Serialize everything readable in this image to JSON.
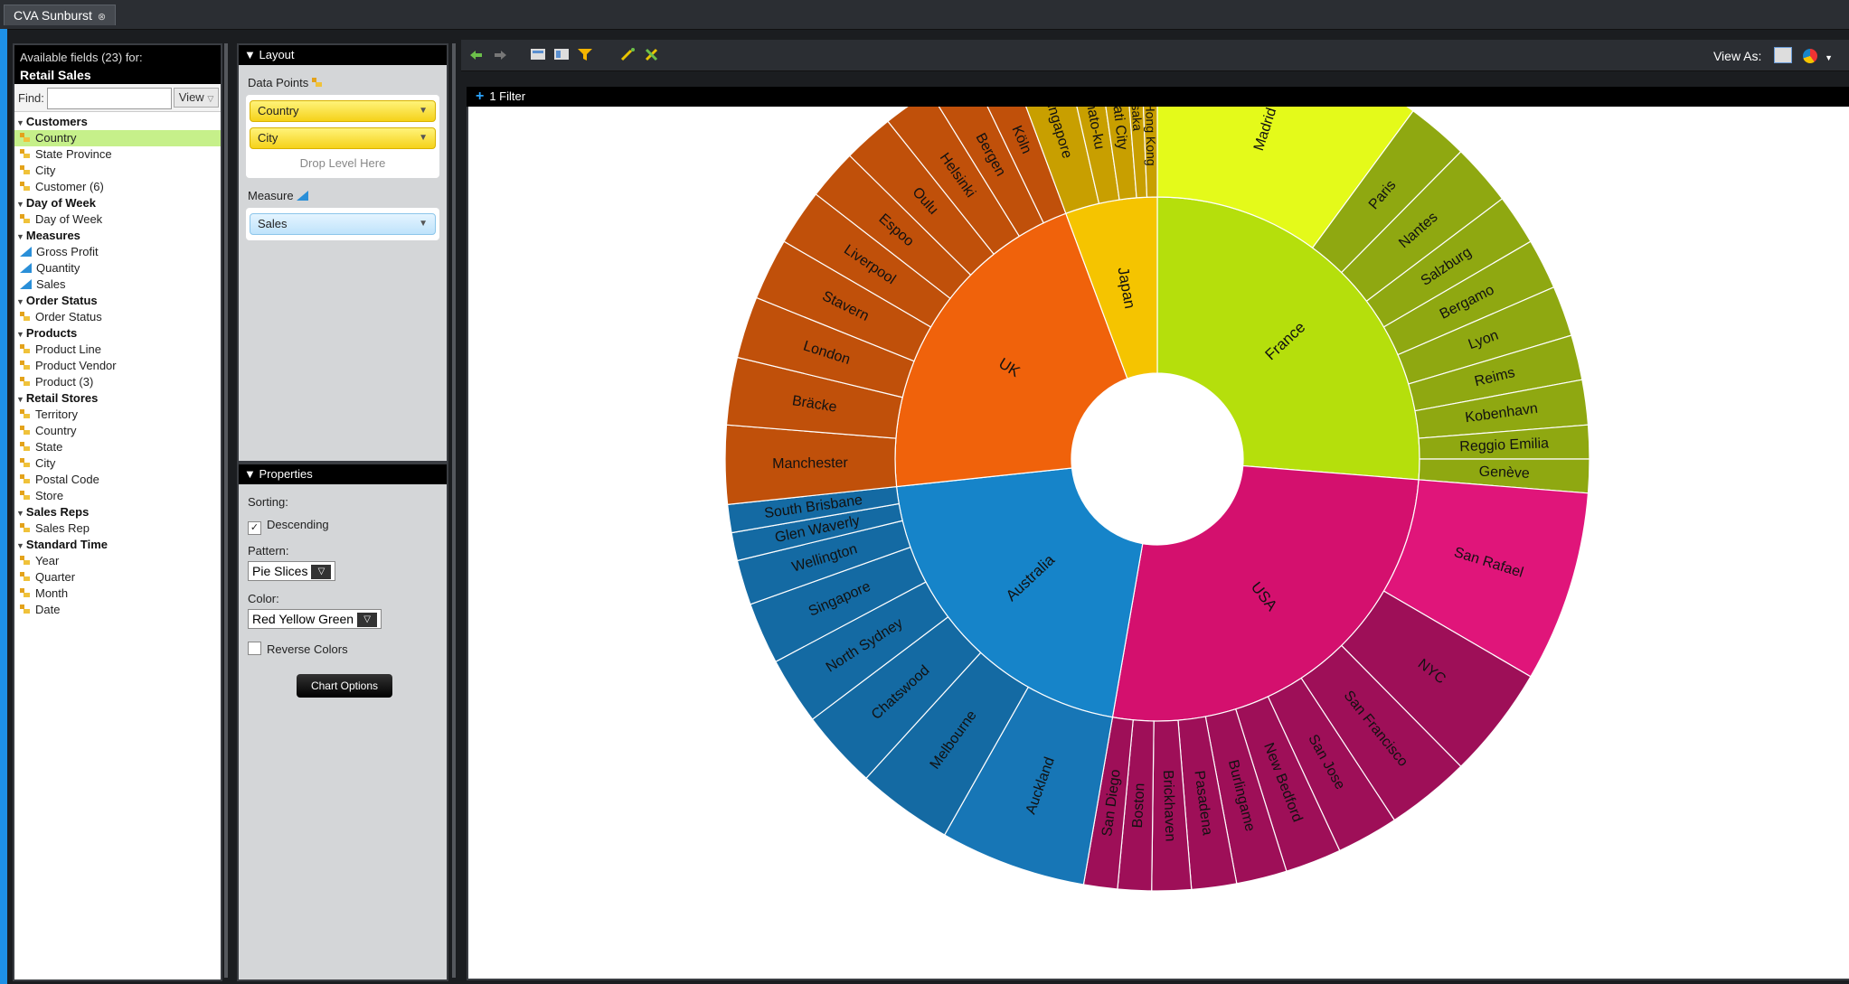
{
  "tab": {
    "title": "CVA Sunburst"
  },
  "fields": {
    "header": "Available fields (23) for:",
    "source": "Retail Sales",
    "find_label": "Find:",
    "find_value": "",
    "view_label": "View",
    "tree": [
      {
        "type": "cat",
        "label": "Customers"
      },
      {
        "type": "dim",
        "label": "Country",
        "selected": true
      },
      {
        "type": "dim",
        "label": "State Province"
      },
      {
        "type": "dim",
        "label": "City"
      },
      {
        "type": "dim",
        "label": "Customer (6)"
      },
      {
        "type": "cat",
        "label": "Day of Week"
      },
      {
        "type": "dim",
        "label": "Day of Week"
      },
      {
        "type": "cat",
        "label": "Measures"
      },
      {
        "type": "meas",
        "label": "Gross Profit"
      },
      {
        "type": "meas",
        "label": "Quantity"
      },
      {
        "type": "meas",
        "label": "Sales"
      },
      {
        "type": "cat",
        "label": "Order Status"
      },
      {
        "type": "dim",
        "label": "Order Status"
      },
      {
        "type": "cat",
        "label": "Products"
      },
      {
        "type": "dim",
        "label": "Product Line"
      },
      {
        "type": "dim",
        "label": "Product Vendor"
      },
      {
        "type": "dim",
        "label": "Product (3)"
      },
      {
        "type": "cat",
        "label": "Retail Stores"
      },
      {
        "type": "dim",
        "label": "Territory"
      },
      {
        "type": "dim",
        "label": "Country"
      },
      {
        "type": "dim",
        "label": "State"
      },
      {
        "type": "dim",
        "label": "City"
      },
      {
        "type": "dim",
        "label": "Postal Code"
      },
      {
        "type": "dim",
        "label": "Store"
      },
      {
        "type": "cat",
        "label": "Sales Reps"
      },
      {
        "type": "dim",
        "label": "Sales Rep"
      },
      {
        "type": "cat",
        "label": "Standard Time"
      },
      {
        "type": "dim",
        "label": "Year"
      },
      {
        "type": "dim",
        "label": "Quarter"
      },
      {
        "type": "dim",
        "label": "Month"
      },
      {
        "type": "dim",
        "label": "Date"
      }
    ]
  },
  "layout": {
    "title": "▼ Layout",
    "data_points_label": "Data Points",
    "data_points": [
      "Country",
      "City"
    ],
    "drop_level": "Drop Level Here",
    "measure_label": "Measure",
    "measure": "Sales"
  },
  "properties": {
    "title": "▼ Properties",
    "sorting_label": "Sorting:",
    "descending_label": "Descending",
    "descending_checked": true,
    "pattern_label": "Pattern:",
    "pattern_value": "Pie Slices",
    "color_label": "Color:",
    "color_value": "Red Yellow Green",
    "reverse_label": "Reverse Colors",
    "reverse_checked": false,
    "chart_options": "Chart Options"
  },
  "toolbar": {
    "view_as": "View As:"
  },
  "filter": {
    "label": "1 Filter"
  },
  "chart_data": {
    "type": "sunburst",
    "measure": "Sales",
    "levels": [
      "Country",
      "City"
    ],
    "nodes": [
      {
        "name": "France",
        "color": "#b5df0c",
        "children": [
          {
            "name": "Madrid",
            "value": 48,
            "color": "#e4fa1a"
          },
          {
            "name": "Paris",
            "value": 11,
            "color": "#8fa811"
          },
          {
            "name": "Nantes",
            "value": 11,
            "color": "#8fa811"
          },
          {
            "name": "Salzburg",
            "value": 9,
            "color": "#8fa811"
          },
          {
            "name": "Bergamo",
            "value": 9,
            "color": "#8fa811"
          },
          {
            "name": "Lyon",
            "value": 9,
            "color": "#8fa811"
          },
          {
            "name": "Reims",
            "value": 8,
            "color": "#8fa811"
          },
          {
            "name": "Kobenhavn",
            "value": 8,
            "color": "#8fa811"
          },
          {
            "name": "Reggio Emilia",
            "value": 6,
            "color": "#8fa811"
          },
          {
            "name": "Genève",
            "value": 6,
            "color": "#8fa811"
          }
        ]
      },
      {
        "name": "USA",
        "color": "#d4106e",
        "children": [
          {
            "name": "San Rafael",
            "value": 34,
            "color": "#e0157a"
          },
          {
            "name": "NYC",
            "value": 20,
            "color": "#9e0f58"
          },
          {
            "name": "San Francisco",
            "value": 15,
            "color": "#9e0f58"
          },
          {
            "name": "San Jose",
            "value": 11,
            "color": "#9e0f58"
          },
          {
            "name": "New Bedford",
            "value": 10,
            "color": "#9e0f58"
          },
          {
            "name": "Burlingame",
            "value": 9,
            "color": "#9e0f58"
          },
          {
            "name": "Pasadena",
            "value": 8,
            "color": "#9e0f58"
          },
          {
            "name": "Brickhaven",
            "value": 7,
            "color": "#9e0f58"
          },
          {
            "name": "Boston",
            "value": 6,
            "color": "#9e0f58"
          },
          {
            "name": "San Diego",
            "value": 6,
            "color": "#9e0f58"
          }
        ]
      },
      {
        "name": "Australia",
        "color": "#1684c9",
        "children": [
          {
            "name": "Auckland",
            "value": 26,
            "color": "#1776b6"
          },
          {
            "name": "Melbourne",
            "value": 17,
            "color": "#146aa3"
          },
          {
            "name": "Chatswood",
            "value": 14,
            "color": "#146aa3"
          },
          {
            "name": "North Sydney",
            "value": 12,
            "color": "#146aa3"
          },
          {
            "name": "Singapore",
            "value": 11,
            "color": "#146aa3"
          },
          {
            "name": "Wellington",
            "value": 8,
            "color": "#146aa3"
          },
          {
            "name": "Glen Waverly",
            "value": 5,
            "color": "#146aa3"
          },
          {
            "name": "South Brisbane",
            "value": 5,
            "color": "#146aa3"
          }
        ]
      },
      {
        "name": "UK",
        "color": "#f0620b",
        "children": [
          {
            "name": "Manchester",
            "value": 14,
            "color": "#c0500a"
          },
          {
            "name": "Bräcke",
            "value": 12,
            "color": "#c0500a"
          },
          {
            "name": "London",
            "value": 11,
            "color": "#c0500a"
          },
          {
            "name": "Stavern",
            "value": 11,
            "color": "#c0500a"
          },
          {
            "name": "Liverpool",
            "value": 10,
            "color": "#c0500a"
          },
          {
            "name": "Espoo",
            "value": 9,
            "color": "#c0500a"
          },
          {
            "name": "Oulu",
            "value": 9,
            "color": "#c0500a"
          },
          {
            "name": "Helsinki",
            "value": 9,
            "color": "#c0500a"
          },
          {
            "name": "Bergen",
            "value": 8,
            "color": "#c0500a"
          },
          {
            "name": "Köln",
            "value": 7,
            "color": "#c0500a"
          }
        ]
      },
      {
        "name": "Japan",
        "color": "#f5c400",
        "children": [
          {
            "name": "Singapore",
            "value": 10,
            "color": "#c89f00"
          },
          {
            "name": "Minato-ku",
            "value": 6,
            "color": "#c89f00"
          },
          {
            "name": "Makati City",
            "value": 5,
            "color": "#c89f00"
          },
          {
            "name": "Osaka",
            "value": 3,
            "color": "#c89f00"
          },
          {
            "name": "Central Hong Kong",
            "value": 3,
            "color": "#c89f00"
          }
        ]
      }
    ]
  }
}
